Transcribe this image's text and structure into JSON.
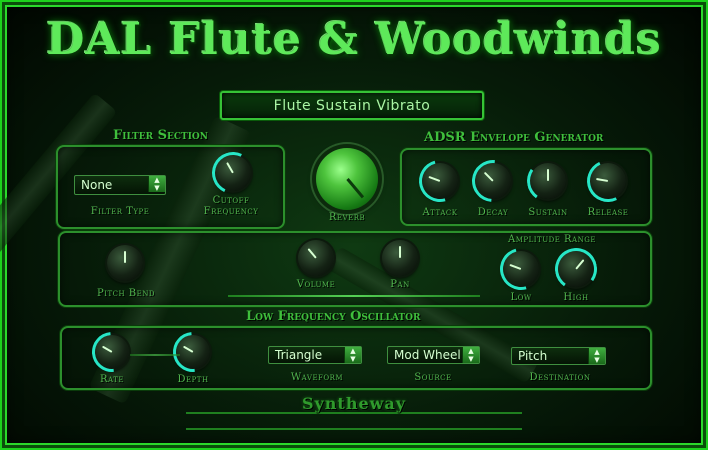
{
  "title": "DAL Flute & Woodwinds",
  "preset": "Flute Sustain Vibrato",
  "filter": {
    "title": "Filter Section",
    "type_label": "Filter Type",
    "type_value": "None",
    "cutoff_label_1": "Cutoff",
    "cutoff_label_2": "Frequency"
  },
  "reverb_label": "Reverb",
  "adsr": {
    "title": "ADSR Envelope Generator",
    "attack": "Attack",
    "decay": "Decay",
    "sustain": "Sustain",
    "release": "Release"
  },
  "mid": {
    "pitch_bend": "Pitch Bend",
    "volume": "Volume",
    "pan": "Pan",
    "amp_range": "Amplitude Range",
    "low": "Low",
    "high": "High"
  },
  "lfo": {
    "title": "Low Frequency Oscillator",
    "rate": "Rate",
    "depth": "Depth",
    "waveform_label": "Waveform",
    "waveform_value": "Triangle",
    "source_label": "Source",
    "source_value": "Mod Wheel",
    "destination_label": "Destination",
    "destination_value": "Pitch"
  },
  "brand": "Syntheway",
  "colors": {
    "accent": "#1dd21d",
    "knob_arc": "#27e6c6",
    "text": "#52b64f"
  }
}
